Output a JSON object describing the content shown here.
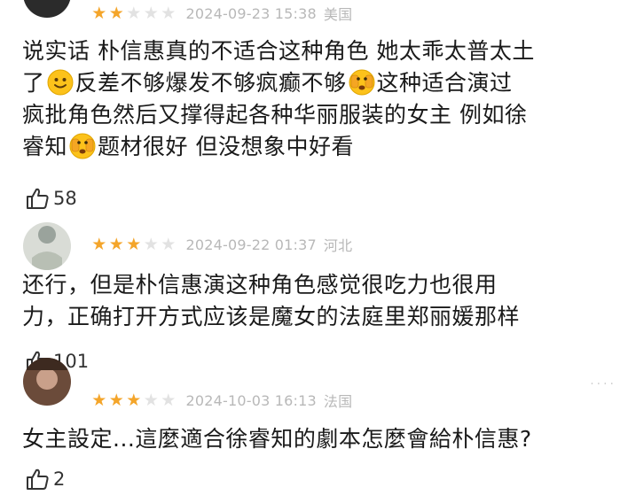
{
  "reviews": [
    {
      "stars": 2,
      "date": "2024-09-23 15:38",
      "location": "美国",
      "line1": "说实话 朴信惠真的不适合这种角色 她太乖太普太土",
      "line2a": "了",
      "line2b": "反差不够爆发不够疯癫不够",
      "line2c": "这种适合演过",
      "line3": "疯批角色然后又撑得起各种华丽服装的女主 例如徐",
      "line4a": "睿知",
      "line4b": "题材很好 但没想象中好看",
      "likes": "58"
    },
    {
      "stars": 3,
      "date": "2024-09-22 01:37",
      "location": "河北",
      "line1": "还行，但是朴信惠演这种角色感觉很吃力也很用",
      "line2": "力，正确打开方式应该是魔女的法庭里郑丽媛那样",
      "likes": "101"
    },
    {
      "stars": 3,
      "date": "2024-10-03 16:13",
      "location": "法国",
      "line1": "女主設定...這麼適合徐睿知的劇本怎麼會給朴信惠?",
      "likes": "2"
    }
  ],
  "icons": {
    "star": "star-icon",
    "like": "thumbs-up-icon",
    "emoji_smile": "slightly-smiling-face-icon",
    "emoji_peek": "face-with-peeking-eye-icon"
  },
  "colors": {
    "star_on": "#f4a52a",
    "star_off": "#e2e2e2",
    "meta": "#b8b8b8"
  }
}
